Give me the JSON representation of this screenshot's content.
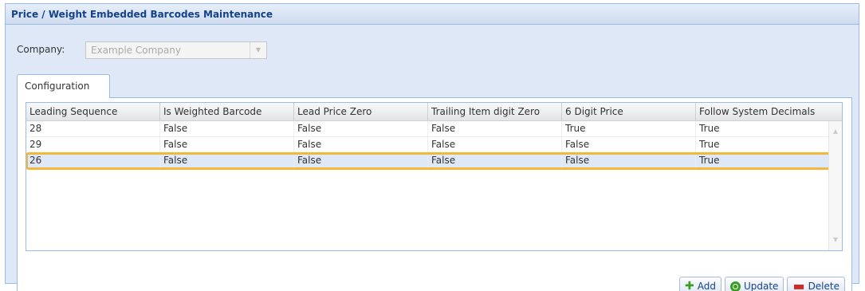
{
  "panel": {
    "title": "Price / Weight Embedded Barcodes Maintenance"
  },
  "company": {
    "label": "Company:",
    "value": "Example Company"
  },
  "tabs": [
    {
      "label": "Configuration"
    }
  ],
  "grid": {
    "columns": [
      "Leading Sequence",
      "Is Weighted Barcode",
      "Lead Price Zero",
      "Trailing Item digit Zero",
      "6 Digit Price",
      "Follow System Decimals"
    ],
    "rows": [
      [
        "28",
        "False",
        "False",
        "False",
        "True",
        "True"
      ],
      [
        "29",
        "False",
        "False",
        "False",
        "False",
        "True"
      ],
      [
        "26",
        "False",
        "False",
        "False",
        "False",
        "True"
      ]
    ],
    "selected_row": 2
  },
  "buttons": {
    "add": "Add",
    "update": "Update",
    "delete": "Delete"
  },
  "colors": {
    "accent": "#99bbe8",
    "highlight": "#f0b93b",
    "title": "#15428b"
  }
}
